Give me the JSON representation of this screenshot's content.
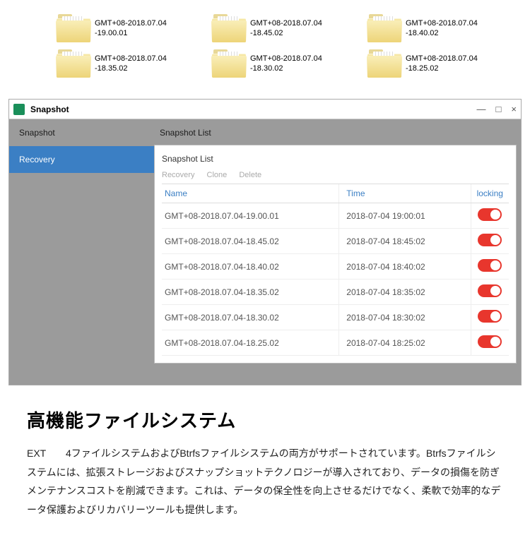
{
  "folders": [
    {
      "l1": "GMT+08-2018.07.04",
      "l2": "-19.00.01"
    },
    {
      "l1": "GMT+08-2018.07.04",
      "l2": "-18.45.02"
    },
    {
      "l1": "GMT+08-2018.07.04",
      "l2": "-18.40.02"
    },
    {
      "l1": "GMT+08-2018.07.04",
      "l2": "-18.35.02"
    },
    {
      "l1": "GMT+08-2018.07.04",
      "l2": "-18.30.02"
    },
    {
      "l1": "GMT+08-2018.07.04",
      "l2": "-18.25.02"
    }
  ],
  "app": {
    "title": "Snapshot",
    "win": {
      "min": "—",
      "max": "□",
      "close": "×"
    },
    "sidebar": {
      "snapshot": "Snapshot",
      "recovery": "Recovery"
    },
    "panelTitle": "Snapshot List",
    "listTitle": "Snapshot List",
    "actions": {
      "recovery": "Recovery",
      "clone": "Clone",
      "delete": "Delete"
    },
    "cols": {
      "name": "Name",
      "time": "Time",
      "locking": "locking"
    },
    "rows": [
      {
        "name": "GMT+08-2018.07.04-19.00.01",
        "time": "2018-07-04 19:00:01"
      },
      {
        "name": "GMT+08-2018.07.04-18.45.02",
        "time": "2018-07-04 18:45:02"
      },
      {
        "name": "GMT+08-2018.07.04-18.40.02",
        "time": "2018-07-04 18:40:02"
      },
      {
        "name": "GMT+08-2018.07.04-18.35.02",
        "time": "2018-07-04 18:35:02"
      },
      {
        "name": "GMT+08-2018.07.04-18.30.02",
        "time": "2018-07-04 18:30:02"
      },
      {
        "name": "GMT+08-2018.07.04-18.25.02",
        "time": "2018-07-04 18:25:02"
      }
    ]
  },
  "article": {
    "heading": "高機能ファイルシステム",
    "body": "EXT　　4ファイルシステムおよびBtrfsファイルシステムの両方がサポートされています。Btrfsファイルシステムには、拡張ストレージおよびスナップショットテクノロジーが導入されており、データの損傷を防ぎメンテナンスコストを削減できます。これは、データの保全性を向上させるだけでなく、柔軟で効率的なデータ保護およびリカバリーツールも提供します。"
  }
}
